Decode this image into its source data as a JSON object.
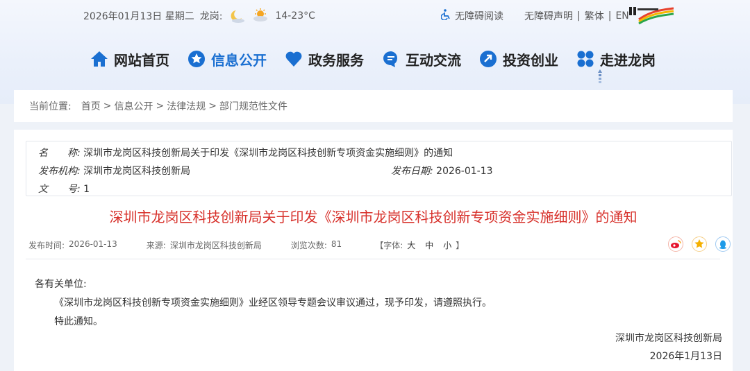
{
  "topbar": {
    "date": "2026年01月13日 星期二",
    "location": "龙岗:",
    "temp": "14-23°C",
    "accessibility_read": "无障碍阅读",
    "accessibility_statement": "无障碍声明",
    "traditional": "繁体",
    "english": "EN",
    "sep": "|"
  },
  "nav": {
    "items": [
      {
        "label": "网站首页",
        "icon": "home-icon"
      },
      {
        "label": "信息公开",
        "icon": "star-badge-icon"
      },
      {
        "label": "政务服务",
        "icon": "heart-icon"
      },
      {
        "label": "互动交流",
        "icon": "chat-icon"
      },
      {
        "label": "投资创业",
        "icon": "arrow-circle-icon"
      },
      {
        "label": "走进龙岗",
        "icon": "grid-clover-icon"
      }
    ],
    "active_color": "#1a6fd1"
  },
  "breadcrumb": {
    "label": "当前位置:",
    "items": [
      "首页",
      "信息公开",
      "法律法规",
      "部门规范性文件"
    ],
    "sep": ">"
  },
  "meta": {
    "name_label": "名　　称:",
    "name_value": "深圳市龙岗区科技创新局关于印发《深圳市龙岗区科技创新专项资金实施细则》的通知",
    "org_label": "发布机构:",
    "org_value": "深圳市龙岗区科技创新局",
    "date_label": "发布日期:",
    "date_value": "2026-01-13",
    "num_label": "文　　号:",
    "num_value": "1"
  },
  "article": {
    "title": "深圳市龙岗区科技创新局关于印发《深圳市龙岗区科技创新专项资金实施细则》的通知",
    "title_color": "#d7302a",
    "publish_time_label": "发布时间:",
    "publish_time": "2026-01-13",
    "source_label": "来源:",
    "source": "深圳市龙岗区科技创新局",
    "views_label": "浏览次数:",
    "views": "81",
    "font_label": "【字体:",
    "font_large": "大",
    "font_medium": "中",
    "font_small": "小",
    "font_close": "】",
    "greeting": "各有关单位:",
    "para1": "《深圳市龙岗区科技创新专项资金实施细则》业经区领导专题会议审议通过，现予印发，请遵照执行。",
    "para2": "特此通知。",
    "signature": "深圳市龙岗区科技创新局",
    "sign_date": "2026年1月13日"
  },
  "share": [
    "weibo-icon",
    "favorite-star-icon",
    "qq-icon"
  ]
}
